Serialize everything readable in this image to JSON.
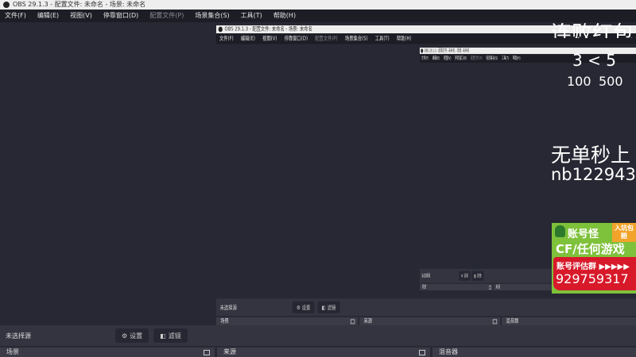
{
  "window": {
    "title": "OBS 29.1.3 - 配置文件: 未命名 - 场景: 未命名"
  },
  "menu": [
    "文件(F)",
    "编辑(E)",
    "视图(V)",
    "停靠窗口(D)",
    "配置文件(P)",
    "场景集合(S)",
    "工具(T)",
    "帮助(H)"
  ],
  "source_bar": {
    "label": "未选择源",
    "settings": "设置",
    "filters": "滤镜"
  },
  "docks": {
    "scenes": "场景",
    "sources": "来源",
    "mixer": "混音器"
  },
  "overlay": {
    "line1": "连败红包",
    "line2": "3 < 5",
    "line3a": "100",
    "line3b": "500",
    "line4": "无单秒上",
    "line5": "nb122943"
  },
  "ad": {
    "brand": "账号怪",
    "badge": "入坑包赔",
    "games": "CF/任何游戏",
    "group": "账号评估群 ▶▶▶▶▶",
    "number": "929759317"
  },
  "colors": {
    "ad_green": "#7ec13a",
    "ad_red": "#d7192a",
    "ad_orange": "#f2a32a"
  }
}
